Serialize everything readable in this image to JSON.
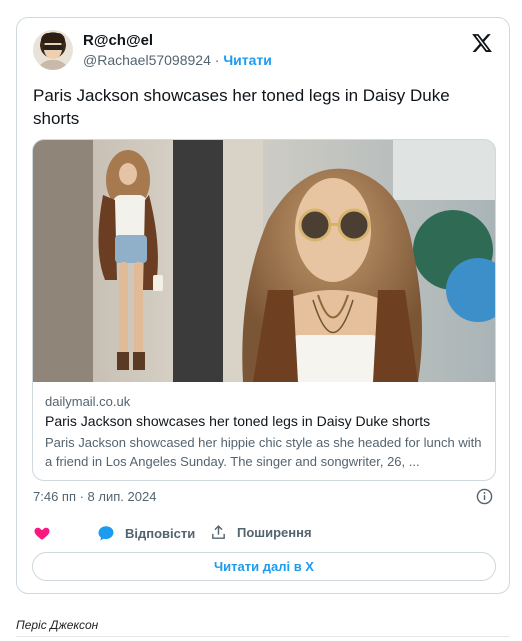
{
  "tweet": {
    "author_name": "R@ch@el",
    "handle": "@Rachael57098924",
    "separator": "·",
    "follow_label": "Читати",
    "text": "Paris Jackson showcases her toned legs in Daisy Duke shorts",
    "link_card": {
      "domain": "dailymail.co.uk",
      "title": "Paris Jackson showcases her toned legs in Daisy Duke shorts",
      "description": "Paris Jackson showcased her hippie chic style as she headed for lunch with a friend in Los Angeles Sunday. The singer and songwriter, 26, ..."
    },
    "timestamp": "7:46 пп · 8 лип. 2024",
    "actions": {
      "like_icon": "heart-icon",
      "reply_label": "Відповісти",
      "share_label": "Поширення"
    },
    "read_more_label": "Читати далі в X"
  },
  "caption": "Періс Джексон",
  "colors": {
    "accent": "#1d9bf0",
    "like": "#f91880",
    "text": "#0f1419",
    "muted": "#536471",
    "border": "#cfd9de"
  },
  "icons": [
    "x-logo-icon",
    "info-icon",
    "heart-icon",
    "reply-bubble-icon",
    "share-icon"
  ]
}
